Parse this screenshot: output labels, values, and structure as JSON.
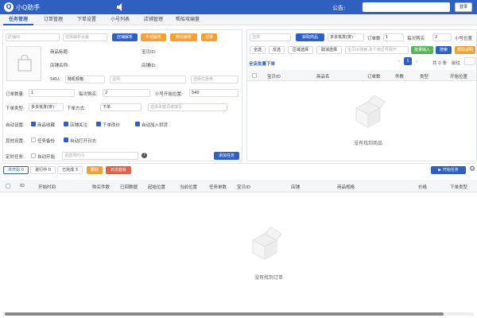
{
  "app": {
    "logo": "Q",
    "title": "小Q助手",
    "notice_label": "公告:",
    "login_label": "登录"
  },
  "tabs": [
    "任务管理",
    "订单管理",
    "下单设置",
    "小号列表",
    "店铺管理",
    "帮船攻编量"
  ],
  "left": {
    "shop_id_placeholder": "店铺ID",
    "parse_device_placeholder": "选择解析设备",
    "btn_shop_parse": "店铺解析",
    "btn_manual_parse": "手动解析",
    "btn_wechat_parse": "微信解析",
    "btn_record": "记录",
    "product_title_label": "商品标题:",
    "shop_name_label": "店铺名称:",
    "baby_id_label": "宝贝ID:",
    "shop_id_label": "店铺ID:",
    "sku_label": "SKU:",
    "sku_value": "随机规格",
    "sku_select_placeholder": "选择",
    "sku_default_placeholder": "选择优惠券",
    "order_qty_label": "订单数量:",
    "order_qty_value": "1",
    "per_buy_label": "每次购买:",
    "per_buy_value": "2",
    "start_pos_label": "小号开始位置:",
    "start_pos_value": "540",
    "order_type_label": "下单类型:",
    "order_type_value": "多多批发(拼)",
    "order_method_label": "下单方式:",
    "order_method_value": "下单",
    "keyword_placeholder": "选择关键词或填写",
    "auto_settings_label": "自动设置:",
    "auto_options": [
      "商品收藏",
      "店铺关注",
      "下单改价",
      "自动加入供货"
    ],
    "other_settings_label": "其他设置:",
    "other_options": [
      "任务备份",
      "自动打开日志"
    ],
    "timer_label": "定时任务:",
    "auto_start_label": "自动开始",
    "time_placeholder": "请选择时间",
    "add_task_btn": "添加任务"
  },
  "right": {
    "select_placeholder": "选择",
    "btn_get_product": "获取商品",
    "order_type_value": "多多批发(拼)",
    "order_qty_label": "订单数",
    "order_qty_value": "1",
    "per_buy_label": "每次购买",
    "per_buy_value": "2",
    "small_pos_label": "小号位置",
    "row_buttons": [
      "全选",
      "反选",
      "区域选择",
      "取消选择"
    ],
    "batch_input_placeholder": "宝贝ID搜索,多个用逗号隔开",
    "btn_batch_input": "批量输入",
    "btn_search": "搜索",
    "btn_more": "帮助说明",
    "section_title": "全店批量下单",
    "page_current": "1",
    "page_total": "共 0 条",
    "goto_label": "前往",
    "columns": [
      "宝贝ID",
      "商品名",
      "订单数",
      "件数",
      "类型",
      "开始位置"
    ],
    "empty_text": "没有找到商品"
  },
  "bottom": {
    "status_tabs": [
      "未开始 0",
      "进行中 0",
      "已完成 3"
    ],
    "btn_delete": "删除",
    "btn_log": "日志面板",
    "btn_start": "开始任务",
    "columns": [
      "ID",
      "开始时间",
      "购买件数",
      "已回数据",
      "起始位置",
      "当前位置",
      "任务单数",
      "宝贝ID",
      "店铺",
      "商品规格",
      "价格",
      "下单类型"
    ],
    "empty_text": "没有找到订单"
  }
}
